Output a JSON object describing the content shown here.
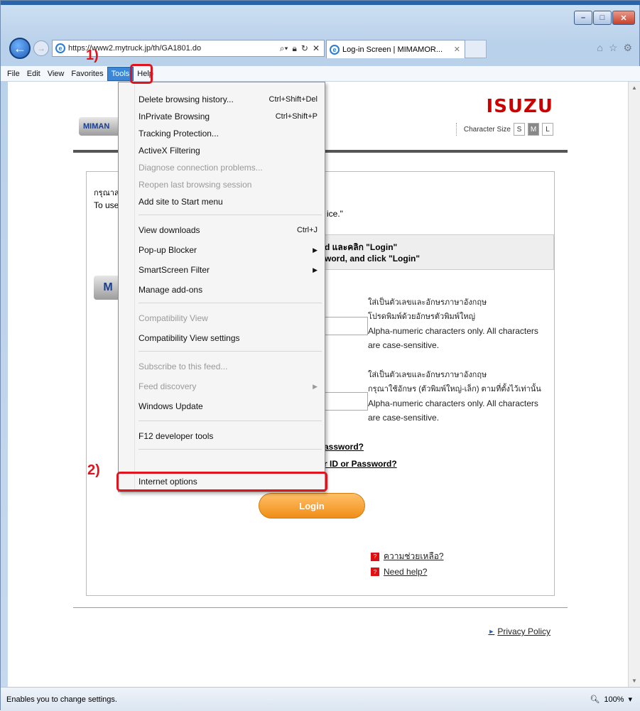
{
  "browser": {
    "address": "https://www2.mytruck.jp/th/GA1801.do",
    "tab_title": "Log-in Screen | MIMAMOR...",
    "ie_glyph": "e"
  },
  "menubar": {
    "items": [
      "File",
      "Edit",
      "View",
      "Favorites",
      "Tools",
      "Help"
    ]
  },
  "tools_menu": {
    "items": [
      {
        "label": "Delete browsing history...",
        "shortcut": "Ctrl+Shift+Del"
      },
      {
        "label": "InPrivate Browsing",
        "shortcut": "Ctrl+Shift+P"
      },
      {
        "label": "Tracking Protection..."
      },
      {
        "label": "ActiveX Filtering"
      },
      {
        "label": "Diagnose connection problems..."
      },
      {
        "label": "Reopen last browsing session"
      },
      {
        "label": "Add site to Start menu"
      },
      {
        "label": "View downloads",
        "shortcut": "Ctrl+J"
      },
      {
        "label": "Pop-up Blocker"
      },
      {
        "label": "SmartScreen Filter"
      },
      {
        "label": "Manage add-ons"
      },
      {
        "label": "Compatibility View"
      },
      {
        "label": "Compatibility View settings"
      },
      {
        "label": "Subscribe to this feed..."
      },
      {
        "label": "Feed discovery"
      },
      {
        "label": "Windows Update"
      },
      {
        "label": "F12 developer tools"
      },
      {
        "label": "Internet options"
      }
    ]
  },
  "annotations": {
    "step1": "1)",
    "step2": "2)"
  },
  "page": {
    "brand": "ISUZU",
    "logo_text": "MIMAN",
    "logo_text2": "M",
    "character_size_label": "Character Size",
    "size_options": [
      "S",
      "M",
      "L"
    ],
    "thai_intro": "กรุณาส",
    "eng_intro": "To use",
    "eng_tail": "ice.\"",
    "instr_line1": "d และคลิก \"Login\"",
    "instr_line2": "word, and click \"Login\"",
    "hint1_th1": "ใส่เป็นตัวเลขและอักษรภาษาอังกฤษ",
    "hint1_th2": "โปรดพิมพ์ด้วยอักษรตัวพิมพ์ใหญ่",
    "hint1_en": "Alpha-numeric characters only. All characters are case-sensitive.",
    "hint2_th1": "ใส่เป็นตัวเลขและอักษรภาษาอังกฤษ",
    "hint2_th2": "กรุณาใช้อักษร (ตัวพิมพ์ใหญ่-เล็ก) ตามที่ตั้งไว้เท่านั้น",
    "hint2_en": "Alpha-numeric characters only. All characters are case-sensitive.",
    "forgot1": "assword?",
    "forgot2": "r ID or Password?",
    "login_label": "Login",
    "help_th": "ความช่วยเหลือ?",
    "help_en": "Need help?",
    "privacy": "Privacy Policy"
  },
  "status": {
    "text": "Enables you to change settings.",
    "zoom": "100%"
  }
}
